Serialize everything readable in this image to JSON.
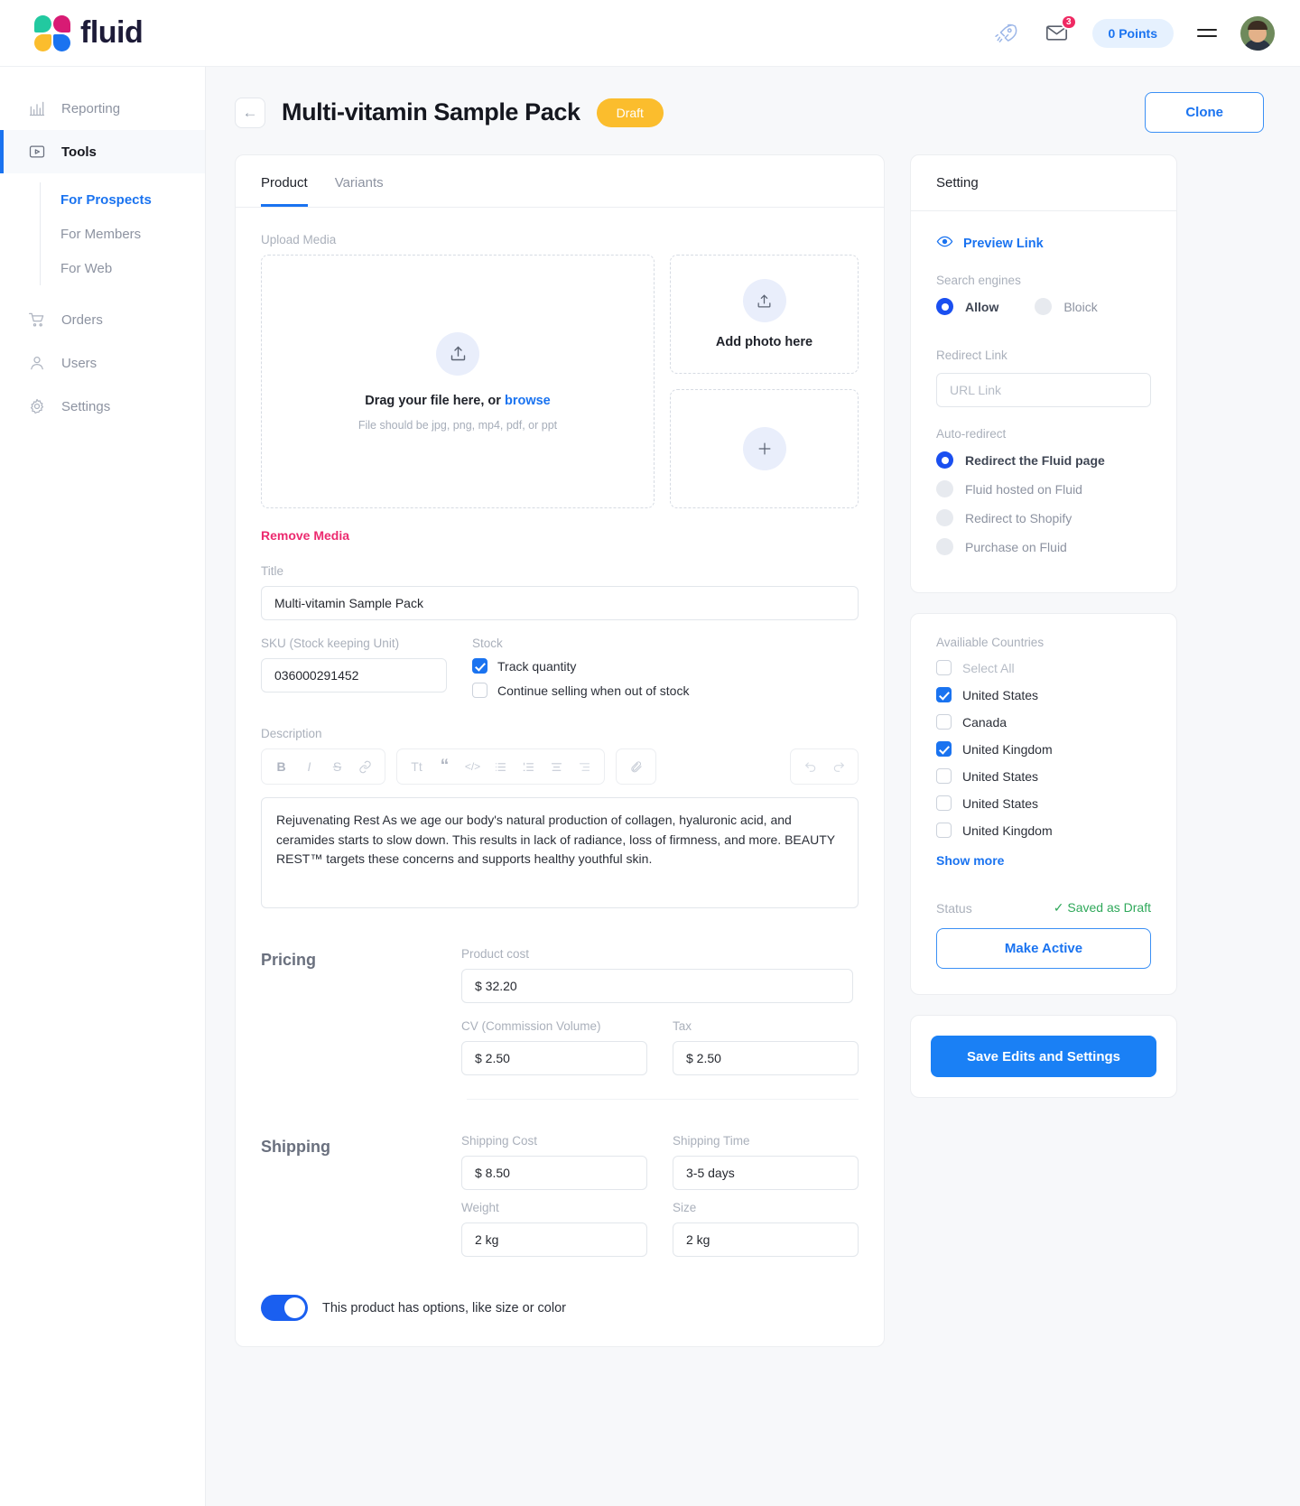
{
  "header": {
    "brand": "fluid",
    "rocket_icon": "rocket-icon",
    "mail_icon": "mail-icon",
    "mail_badge": "3",
    "points_label": "0 Points",
    "menu_icon": "hamburger-icon",
    "avatar_icon": "user-avatar"
  },
  "sidebar": {
    "items": [
      {
        "label": "Reporting",
        "icon": "chart-icon"
      },
      {
        "label": "Tools",
        "icon": "tools-icon"
      },
      {
        "label": "Orders",
        "icon": "cart-icon"
      },
      {
        "label": "Users",
        "icon": "user-icon"
      },
      {
        "label": "Settings",
        "icon": "gear-icon"
      }
    ],
    "subitems": [
      {
        "label": "For Prospects"
      },
      {
        "label": "For Members"
      },
      {
        "label": "For Web"
      }
    ]
  },
  "page": {
    "back_icon": "arrow-left-icon",
    "title": "Multi-vitamin Sample Pack",
    "status_pill": "Draft",
    "clone_label": "Clone"
  },
  "tabs": [
    {
      "label": "Product"
    },
    {
      "label": "Variants"
    }
  ],
  "upload": {
    "section_label": "Upload Media",
    "dropzone_title_main": "Drag your file here, or ",
    "dropzone_title_link": "browse",
    "dropzone_sub": "File should be jpg, png, mp4, pdf, or ppt",
    "tile_add_photo": "Add photo here",
    "remove_media": "Remove Media"
  },
  "form": {
    "title_label": "Title",
    "title_value": "Multi-vitamin Sample Pack",
    "sku_label": "SKU (Stock keeping Unit)",
    "sku_value": "036000291452",
    "stock_label": "Stock",
    "track_quantity": "Track quantity",
    "continue_selling": "Continue selling when out of stock",
    "description_label": "Description",
    "description_value": "Rejuvenating Rest As we age our body's natural production of collagen, hyaluronic acid, and ceramides starts to slow down. This results in lack of radiance, loss of firmness, and more. BEAUTY REST™ targets these concerns and supports healthy youthful skin."
  },
  "editor_toolbar": {
    "bold": "B",
    "italic": "I",
    "strike": "S",
    "link": "🔗",
    "text_style": "Tt",
    "quote": "“",
    "code": "</>",
    "bullet_list": "☰",
    "numbered_list": "≡",
    "align_center": "☰",
    "align_right": "☰",
    "attach": "📎",
    "undo": "↶",
    "redo": "↷"
  },
  "pricing": {
    "section_title": "Pricing",
    "product_cost_label": "Product cost",
    "product_cost_value": "$ 32.20",
    "cv_label": "CV (Commission Volume)",
    "cv_value": "$ 2.50",
    "tax_label": "Tax",
    "tax_value": "$ 2.50"
  },
  "shipping": {
    "section_title": "Shipping",
    "cost_label": "Shipping Cost",
    "cost_value": "$ 8.50",
    "time_label": "Shipping Time",
    "time_value": "3-5 days",
    "weight_label": "Weight",
    "weight_value": "2 kg",
    "size_label": "Size",
    "size_value": "2 kg"
  },
  "options_toggle": {
    "label": "This product has options, like size or color",
    "state": "on"
  },
  "settings": {
    "panel_title": "Setting",
    "preview_link": "Preview Link",
    "preview_icon": "eye-icon",
    "search_engines_label": "Search engines",
    "search_engines": [
      {
        "label": "Allow",
        "selected": true
      },
      {
        "label": "Bloick",
        "selected": false
      }
    ],
    "redirect_link_label": "Redirect Link",
    "redirect_link_placeholder": "URL Link",
    "redirect_link_value": "",
    "auto_redirect_label": "Auto-redirect",
    "auto_redirect": [
      {
        "label": "Redirect the Fluid page",
        "selected": true
      },
      {
        "label": "Fluid hosted on Fluid",
        "selected": false
      },
      {
        "label": "Redirect to Shopify",
        "selected": false
      },
      {
        "label": "Purchase on Fluid",
        "selected": false
      }
    ],
    "countries_label": "Availiable Countries",
    "countries": [
      {
        "label": "Select All",
        "checked": false,
        "muted": true
      },
      {
        "label": "United States",
        "checked": true,
        "muted": false
      },
      {
        "label": "Canada",
        "checked": false,
        "muted": false
      },
      {
        "label": "United Kingdom",
        "checked": true,
        "muted": false
      },
      {
        "label": "United States",
        "checked": false,
        "muted": false
      },
      {
        "label": "United States",
        "checked": false,
        "muted": false
      },
      {
        "label": "United Kingdom",
        "checked": false,
        "muted": false
      }
    ],
    "show_more": "Show more",
    "status_label": "Status",
    "status_value": "✓ Saved as Draft",
    "make_active": "Make Active",
    "save_button": "Save Edits and Settings"
  },
  "colors": {
    "accent_blue": "#1a73f0",
    "draft_yellow": "#fbbd2d",
    "danger_pink": "#ec2a6f",
    "success_green": "#2fa85a"
  }
}
